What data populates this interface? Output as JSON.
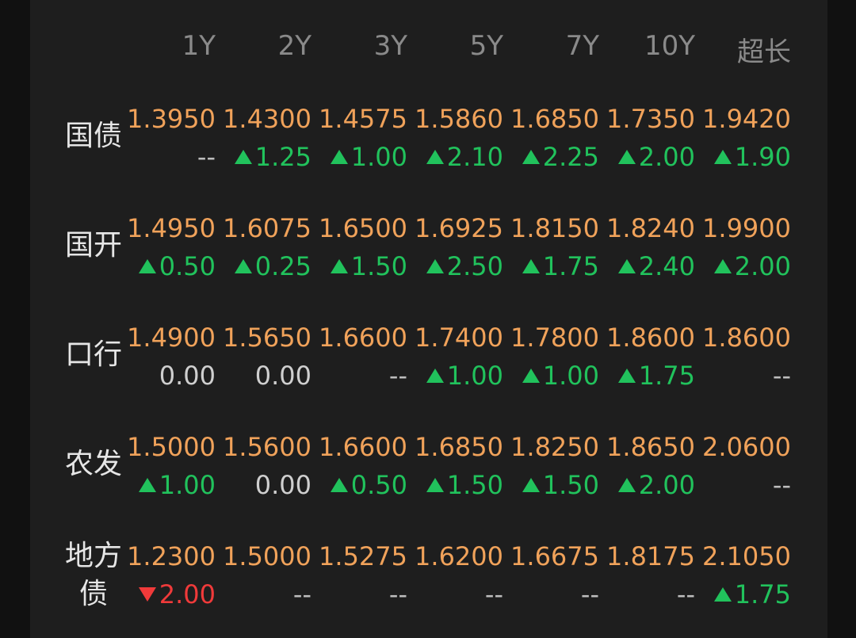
{
  "columns": [
    "1Y",
    "2Y",
    "3Y",
    "5Y",
    "7Y",
    "10Y",
    "超长"
  ],
  "rows": [
    {
      "label": "国债",
      "cells": [
        {
          "rate": "1.3950",
          "change": "--",
          "dir": "none"
        },
        {
          "rate": "1.4300",
          "change": "1.25",
          "dir": "up"
        },
        {
          "rate": "1.4575",
          "change": "1.00",
          "dir": "up"
        },
        {
          "rate": "1.5860",
          "change": "2.10",
          "dir": "up"
        },
        {
          "rate": "1.6850",
          "change": "2.25",
          "dir": "up"
        },
        {
          "rate": "1.7350",
          "change": "2.00",
          "dir": "up"
        },
        {
          "rate": "1.9420",
          "change": "1.90",
          "dir": "up"
        }
      ]
    },
    {
      "label": "国开",
      "cells": [
        {
          "rate": "1.4950",
          "change": "0.50",
          "dir": "up"
        },
        {
          "rate": "1.6075",
          "change": "0.25",
          "dir": "up"
        },
        {
          "rate": "1.6500",
          "change": "1.50",
          "dir": "up"
        },
        {
          "rate": "1.6925",
          "change": "2.50",
          "dir": "up"
        },
        {
          "rate": "1.8150",
          "change": "1.75",
          "dir": "up"
        },
        {
          "rate": "1.8240",
          "change": "2.40",
          "dir": "up"
        },
        {
          "rate": "1.9900",
          "change": "2.00",
          "dir": "up"
        }
      ]
    },
    {
      "label": "口行",
      "cells": [
        {
          "rate": "1.4900",
          "change": "0.00",
          "dir": "flat"
        },
        {
          "rate": "1.5650",
          "change": "0.00",
          "dir": "flat"
        },
        {
          "rate": "1.6600",
          "change": "--",
          "dir": "none"
        },
        {
          "rate": "1.7400",
          "change": "1.00",
          "dir": "up"
        },
        {
          "rate": "1.7800",
          "change": "1.00",
          "dir": "up"
        },
        {
          "rate": "1.8600",
          "change": "1.75",
          "dir": "up"
        },
        {
          "rate": "1.8600",
          "change": "--",
          "dir": "none"
        }
      ]
    },
    {
      "label": "农发",
      "cells": [
        {
          "rate": "1.5000",
          "change": "1.00",
          "dir": "up"
        },
        {
          "rate": "1.5600",
          "change": "0.00",
          "dir": "flat"
        },
        {
          "rate": "1.6600",
          "change": "0.50",
          "dir": "up"
        },
        {
          "rate": "1.6850",
          "change": "1.50",
          "dir": "up"
        },
        {
          "rate": "1.8250",
          "change": "1.50",
          "dir": "up"
        },
        {
          "rate": "1.8650",
          "change": "2.00",
          "dir": "up"
        },
        {
          "rate": "2.0600",
          "change": "--",
          "dir": "none"
        }
      ]
    },
    {
      "label": "地方债",
      "cells": [
        {
          "rate": "1.2300",
          "change": "2.00",
          "dir": "down"
        },
        {
          "rate": "1.5000",
          "change": "--",
          "dir": "none"
        },
        {
          "rate": "1.5275",
          "change": "--",
          "dir": "none"
        },
        {
          "rate": "1.6200",
          "change": "--",
          "dir": "none"
        },
        {
          "rate": "1.6675",
          "change": "--",
          "dir": "none"
        },
        {
          "rate": "1.8175",
          "change": "--",
          "dir": "none"
        },
        {
          "rate": "2.1050",
          "change": "1.75",
          "dir": "up"
        }
      ]
    }
  ],
  "colors": {
    "rate": "#f0a25a",
    "up": "#21c25c",
    "down": "#f03a3a",
    "header": "#8a8a8a",
    "label": "#e6e6e6"
  }
}
